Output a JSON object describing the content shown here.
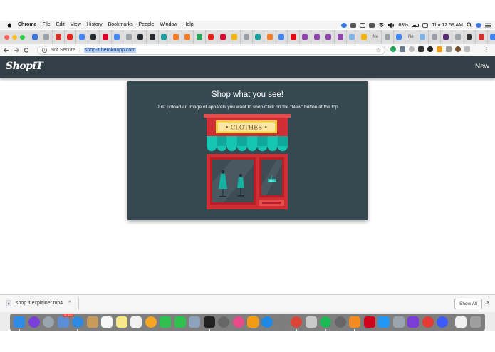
{
  "menubar": {
    "app_name": "Chrome",
    "menus": [
      "File",
      "Edit",
      "View",
      "History",
      "Bookmarks",
      "People",
      "Window",
      "Help"
    ],
    "battery": "63%",
    "clock": "Thu 12:59 AM"
  },
  "browser": {
    "tabs": [
      {
        "icon": "blue-square-icon",
        "color": "#3b73d9"
      },
      {
        "icon": "doc-icon",
        "color": "#9aa0a6"
      },
      {
        "icon": "gmail-icon",
        "color": "#d93025"
      },
      {
        "icon": "youtube-icon",
        "color": "#e62117"
      },
      {
        "icon": "docs-icon",
        "color": "#4285f4"
      },
      {
        "icon": "github-icon",
        "color": "#24292e"
      },
      {
        "icon": "angular-icon",
        "color": "#dd0031"
      },
      {
        "icon": "google-icon",
        "color": "#4285f4"
      },
      {
        "icon": "doc-icon",
        "color": "#9aa0a6"
      },
      {
        "icon": "github-icon",
        "color": "#24292e"
      },
      {
        "icon": "github-icon",
        "color": "#24292e"
      },
      {
        "icon": "teal-icon",
        "color": "#1a9e9e"
      },
      {
        "icon": "orange-icon",
        "color": "#f47b20"
      },
      {
        "icon": "orange-icon",
        "color": "#f47b20"
      },
      {
        "icon": "green-icon",
        "color": "#26a65b"
      },
      {
        "icon": "youtube-icon",
        "color": "#e62117"
      },
      {
        "icon": "angular-icon",
        "color": "#dd0031"
      },
      {
        "icon": "yellow-icon",
        "color": "#f4b400"
      },
      {
        "icon": "doc-icon",
        "color": "#9aa0a6"
      },
      {
        "icon": "teal-icon",
        "color": "#1a9e9e"
      },
      {
        "icon": "orange-icon",
        "color": "#f47b20"
      },
      {
        "icon": "google-icon",
        "color": "#4285f4"
      },
      {
        "icon": "netflix-icon",
        "color": "#e50914"
      },
      {
        "icon": "purple-icon",
        "color": "#8e44ad"
      },
      {
        "icon": "purple-icon",
        "color": "#8e44ad"
      },
      {
        "icon": "purple-icon",
        "color": "#8e44ad"
      },
      {
        "icon": "purple-icon",
        "color": "#8e44ad"
      },
      {
        "icon": "circle-icon",
        "color": "#7fb3e6"
      },
      {
        "icon": "yellow-icon",
        "color": "#f4b400"
      },
      {
        "icon": "doc-icon",
        "color": "#9aa0a6"
      },
      {
        "icon": "google-icon",
        "color": "#4285f4"
      },
      {
        "icon": "circle-icon",
        "color": "#7fb3e6"
      },
      {
        "icon": "doc-icon",
        "color": "#9aa0a6"
      },
      {
        "icon": "dark-purple-icon",
        "color": "#5b2c6f"
      },
      {
        "icon": "doc-icon",
        "color": "#9aa0a6"
      },
      {
        "icon": "mask-icon",
        "color": "#333333"
      },
      {
        "icon": "red-icon",
        "color": "#d32f2f"
      },
      {
        "icon": "google-icon",
        "color": "#4285f4"
      }
    ],
    "tab_labels": {
      "ne1": "Ne",
      "ne2": "Ne"
    },
    "new_tab": "+",
    "tab_close": "×",
    "omnibox": {
      "security": "Not Secure",
      "url": "shop-it.herokuapp.com"
    }
  },
  "app": {
    "brand": "ShopiT",
    "new_link": "New",
    "hero": {
      "title": "Shop what you see!",
      "subtitle": "Just upload an image of apparels you want to shop.Click on the \"New\" button at the top",
      "sign": "• CLOTHES •",
      "tag": "$$$"
    }
  },
  "downloads": {
    "file_name": "shop it explainer.mp4",
    "show_all": "Show All",
    "close": "×"
  },
  "dock": {
    "badge": "30,394",
    "apps": [
      {
        "name": "finder-icon",
        "color": "#2f8ae8"
      },
      {
        "name": "siri-icon",
        "color": "#7a3fd6"
      },
      {
        "name": "launchpad-icon",
        "color": "#9aa4ad"
      },
      {
        "name": "mail-icon",
        "color": "#5a8ed6"
      },
      {
        "name": "safari-icon",
        "color": "#2d8ae0"
      },
      {
        "name": "notebook-icon",
        "color": "#c89b5b"
      },
      {
        "name": "calendar-icon",
        "color": "#f7f7f7"
      },
      {
        "name": "notes-icon",
        "color": "#f7e98a"
      },
      {
        "name": "reminders-icon",
        "color": "#f2f2f2"
      },
      {
        "name": "photos-icon",
        "color": "#f5a623"
      },
      {
        "name": "messages-icon",
        "color": "#2fc14d"
      },
      {
        "name": "facetime-icon",
        "color": "#2fc14d"
      },
      {
        "name": "preview-icon",
        "color": "#8da3bd"
      },
      {
        "name": "terminal-icon",
        "color": "#222222"
      },
      {
        "name": "help-icon",
        "color": "#666666"
      },
      {
        "name": "itunes-icon",
        "color": "#e94b8a"
      },
      {
        "name": "books-icon",
        "color": "#f39c12"
      },
      {
        "name": "appstore-icon",
        "color": "#1e88e5"
      },
      {
        "name": "system-prefs-icon",
        "color": "#7d7d7d"
      },
      {
        "name": "chrome-icon",
        "color": "#db4437"
      },
      {
        "name": "script-editor-icon",
        "color": "#c9c9c9"
      },
      {
        "name": "spotify-icon",
        "color": "#1db954"
      },
      {
        "name": "help-icon",
        "color": "#666666"
      },
      {
        "name": "sublime-icon",
        "color": "#f48b20"
      },
      {
        "name": "red-diamond-icon",
        "color": "#d0021b"
      },
      {
        "name": "circle-arrow-icon",
        "color": "#2196f3"
      },
      {
        "name": "tools-icon",
        "color": "#9aa4ad"
      },
      {
        "name": "star-icon",
        "color": "#7b3fd6"
      },
      {
        "name": "record-icon",
        "color": "#e53935"
      },
      {
        "name": "search-app-icon",
        "color": "#3d5afe"
      },
      {
        "name": "downloads-stack-icon",
        "color": "#f0f0f0"
      },
      {
        "name": "trash-icon",
        "color": "#9e9e9e"
      }
    ]
  }
}
